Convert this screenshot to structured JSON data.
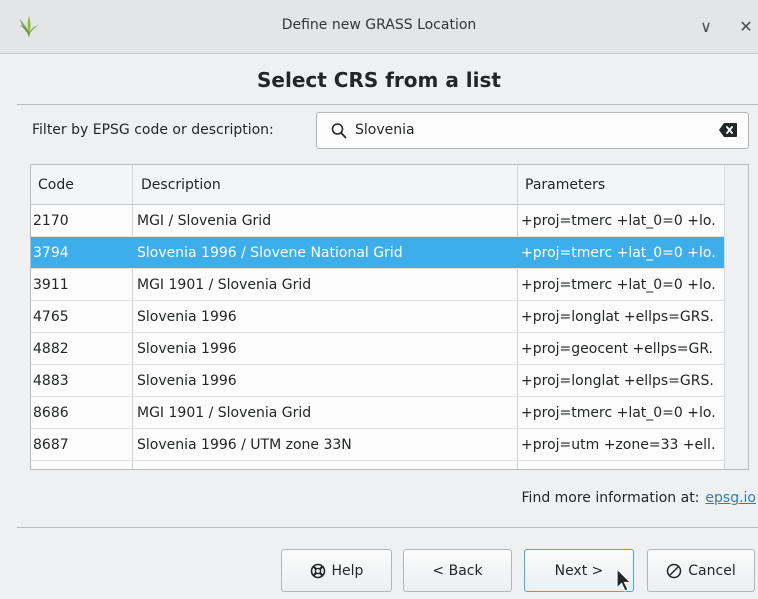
{
  "window": {
    "title": "Define new GRASS Location",
    "minimize_glyph": "∨",
    "close_glyph": "✕"
  },
  "heading": "Select CRS from a list",
  "filter": {
    "label": "Filter by EPSG code or description:",
    "value": "Slovenia",
    "placeholder": ""
  },
  "table": {
    "columns": [
      "Code",
      "Description",
      "Parameters"
    ],
    "rows": [
      {
        "code": "2170",
        "description": "MGI / Slovenia Grid",
        "parameters": "+proj=tmerc +lat_0=0 +lo.",
        "selected": false
      },
      {
        "code": "3794",
        "description": "Slovenia 1996 / Slovene National Grid",
        "parameters": "+proj=tmerc +lat_0=0 +lo.",
        "selected": true
      },
      {
        "code": "3911",
        "description": "MGI 1901 / Slovenia Grid",
        "parameters": "+proj=tmerc +lat_0=0 +lo.",
        "selected": false
      },
      {
        "code": "4765",
        "description": "Slovenia 1996",
        "parameters": "+proj=longlat +ellps=GRS.",
        "selected": false
      },
      {
        "code": "4882",
        "description": "Slovenia 1996",
        "parameters": "+proj=geocent +ellps=GR.",
        "selected": false
      },
      {
        "code": "4883",
        "description": "Slovenia 1996",
        "parameters": "+proj=longlat +ellps=GRS.",
        "selected": false
      },
      {
        "code": "8686",
        "description": "MGI 1901 / Slovenia Grid",
        "parameters": "+proj=tmerc +lat_0=0 +lo.",
        "selected": false
      },
      {
        "code": "8687",
        "description": "Slovenia 1996 / UTM zone 33N",
        "parameters": "+proj=utm +zone=33 +ell.",
        "selected": false
      }
    ]
  },
  "more_info": {
    "text": "Find more information at:",
    "link": "epsg.io"
  },
  "buttons": {
    "help": "Help",
    "back": "< Back",
    "next": "Next >",
    "cancel": "Cancel"
  },
  "colors": {
    "selection": "#3daee9",
    "link": "#2980b9"
  }
}
